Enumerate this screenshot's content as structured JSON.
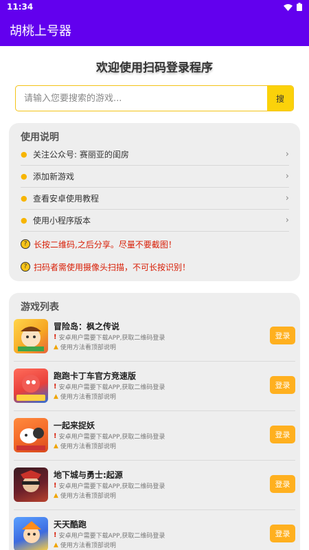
{
  "status_bar": {
    "time": "11:34"
  },
  "app_bar": {
    "title": "胡桃上号器"
  },
  "welcome": {
    "title": "欢迎使用扫码登录程序"
  },
  "search": {
    "placeholder": "请输入您要搜索的游戏...",
    "button_label": "搜"
  },
  "instructions": {
    "title": "使用说明",
    "items": [
      {
        "label": "关注公众号: 赛丽亚的闺房"
      },
      {
        "label": "添加新游戏"
      },
      {
        "label": "查看安卓使用教程"
      },
      {
        "label": "使用小程序版本"
      }
    ],
    "warnings": [
      {
        "label": "长按二维码,之后分享。尽量不要截图！"
      },
      {
        "label": "扫码者需使用摄像头扫描，不可长按识别！"
      }
    ]
  },
  "games": {
    "title": "游戏列表",
    "login_label": "登录",
    "line1": "安卓用户需要下载APP,获取二维码登录",
    "line2": "使用方法看顶部说明",
    "items": [
      {
        "name": "冒险岛：枫之传说",
        "icon": "maplestory-icon",
        "color": "#f6a623"
      },
      {
        "name": "跑跑卡丁车官方竞速版",
        "icon": "kartrider-icon",
        "color": "#e8403b"
      },
      {
        "name": "一起来捉妖",
        "icon": "catch-monster-icon",
        "color": "#3f8de0"
      },
      {
        "name": "地下城与勇士:起源",
        "icon": "dnf-icon",
        "color": "#6b1f2a"
      },
      {
        "name": "天天酷跑",
        "icon": "parkour-icon",
        "color": "#3d6be0"
      }
    ]
  }
}
